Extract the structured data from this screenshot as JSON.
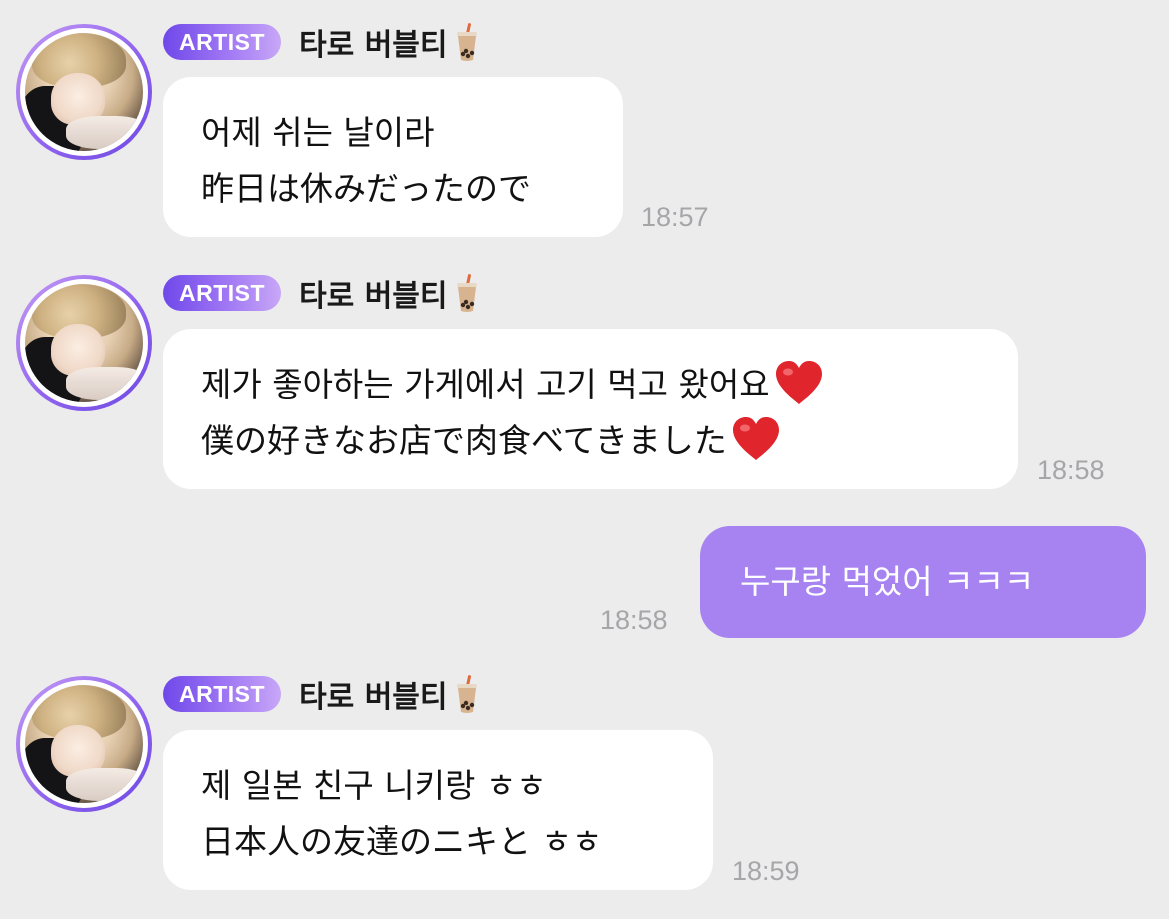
{
  "colors": {
    "background": "#ececed",
    "bubble_incoming": "#ffffff",
    "bubble_outgoing": "#a683f1",
    "badge_start": "#6f48ea",
    "badge_end": "#c8a7f7",
    "time_text": "#a6a6a9"
  },
  "messages": [
    {
      "sender": {
        "badge": "ARTIST",
        "name": "타로 버블티",
        "name_icon": "bubble-tea-icon",
        "avatar": "artist-avatar"
      },
      "lines": [
        "어제 쉬는 날이라",
        "昨日は休みだったので"
      ],
      "time": "18:57"
    },
    {
      "sender": {
        "badge": "ARTIST",
        "name": "타로 버블티",
        "name_icon": "bubble-tea-icon",
        "avatar": "artist-avatar"
      },
      "lines": [
        "제가 좋아하는 가게에서 고기 먹고 왔어요",
        "僕の好きなお店で肉食べてきました"
      ],
      "line_icons": [
        "red-heart-icon",
        "red-heart-icon"
      ],
      "time": "18:58"
    },
    {
      "mine": true,
      "lines": [
        "누구랑 먹었어 ㅋㅋㅋ"
      ],
      "time": "18:58"
    },
    {
      "sender": {
        "badge": "ARTIST",
        "name": "타로 버블티",
        "name_icon": "bubble-tea-icon",
        "avatar": "artist-avatar"
      },
      "lines": [
        "제 일본 친구 니키랑 ㅎㅎ",
        "日本人の友達のニキと ㅎㅎ"
      ],
      "time": "18:59"
    }
  ]
}
